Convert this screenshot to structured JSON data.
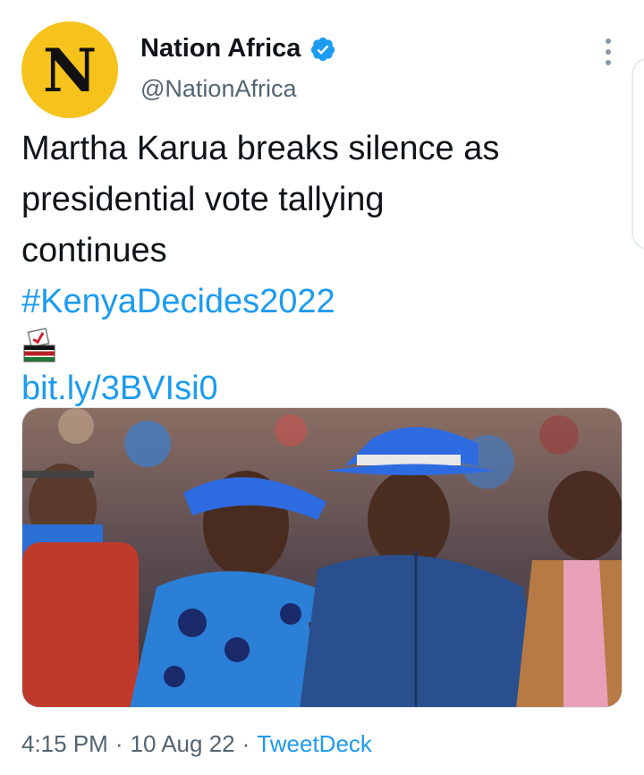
{
  "account": {
    "avatar_letter": "N",
    "avatar_color": "#f6c21c",
    "display_name": "Nation Africa",
    "handle": "@NationAfrica",
    "verified": true,
    "verified_icon": "verified-badge-icon"
  },
  "tweet": {
    "text_lines": [
      "Martha Karua breaks silence as",
      "presidential vote tallying",
      "continues"
    ],
    "hashtag": "#KenyaDecides2022",
    "hashtag_emoji_icon": "ballot-box-kenya-flag-icon",
    "link": "bit.ly/3BVIsi0"
  },
  "media": {
    "icon": "photo",
    "description_icon": "news-photo"
  },
  "footer": {
    "time": "4:15 PM",
    "date": "10 Aug 22",
    "separator": "·",
    "source": "TweetDeck"
  },
  "colors": {
    "link": "#1d9bf0",
    "text": "#0f1419",
    "secondary": "#536471"
  }
}
